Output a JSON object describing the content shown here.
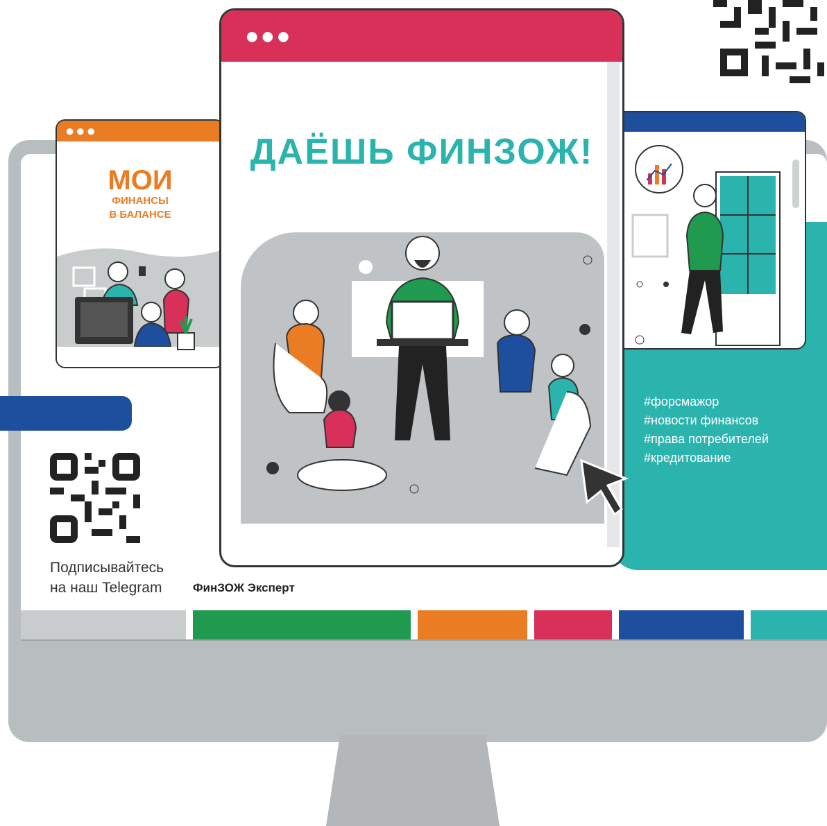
{
  "main_window": {
    "headline": "ДАЁШЬ ФИНЗОЖ!",
    "dots": "●●●"
  },
  "left_window": {
    "title_big": "МОИ",
    "title_line2": "ФИНАНСЫ",
    "title_line3": "В БАЛАНСЕ",
    "dots": "●●●"
  },
  "right_panel": {
    "tags": [
      "#форсмажор",
      "#новости финансов",
      "#права потребителей",
      "#кредитование"
    ]
  },
  "subscribe": {
    "line1": "Подписывайтесь",
    "line2": "на наш Telegram",
    "brand": "ФинЗОЖ Эксперт"
  },
  "colors": {
    "green": "#1f9a4f",
    "orange": "#ea7d23",
    "crimson": "#d9305a",
    "blue": "#1d4f9e",
    "teal": "#2bb3ae"
  }
}
